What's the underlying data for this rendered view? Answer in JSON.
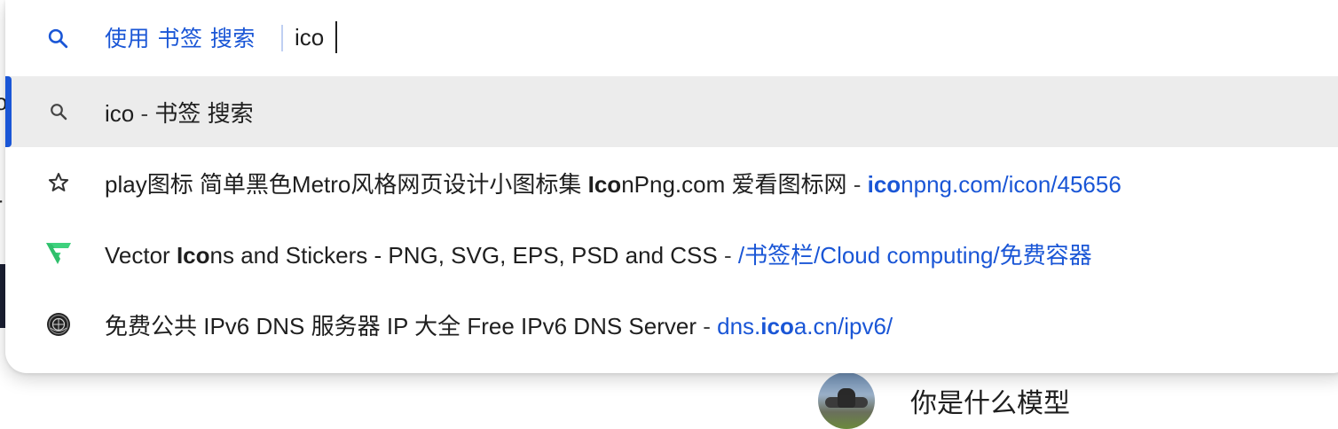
{
  "background": {
    "chat_message": "你是什么模型"
  },
  "omnibox": {
    "keyword_mode_label": "使用 书签 搜索",
    "query": "ico",
    "suggestions": [
      {
        "type": "search",
        "icon": "search-icon",
        "query": "ico",
        "separator": " - ",
        "description": "书签 搜索",
        "selected": true
      },
      {
        "type": "bookmark",
        "icon": "star-icon",
        "title_before": "play图标 简单黑色Metro风格网页设计小图标集 ",
        "title_match": "Ico",
        "title_after": "nPng.com 爱看图标网",
        "separator": " - ",
        "url_match": "ico",
        "url_after": "npng.com/icon/45656"
      },
      {
        "type": "bookmark",
        "icon": "vector-logo-icon",
        "title_before": "Vector ",
        "title_match": "Ico",
        "title_after": "ns and Stickers - PNG, SVG, EPS, PSD and CSS",
        "separator": " - ",
        "url_before": "/书签栏/Cloud computing/免费容器"
      },
      {
        "type": "bookmark",
        "icon": "globe-seal-icon",
        "title_before": "免费公共 IPv6 DNS 服务器 IP 大全 Free IPv6 DNS Server",
        "separator": " - ",
        "url_before": "dns.",
        "url_match": "ico",
        "url_after": "a.cn/ipv6/"
      }
    ]
  },
  "colors": {
    "accent": "#1a56d6",
    "selected_row_bg": "#ececec",
    "vector_logo": "#3ed17d"
  }
}
